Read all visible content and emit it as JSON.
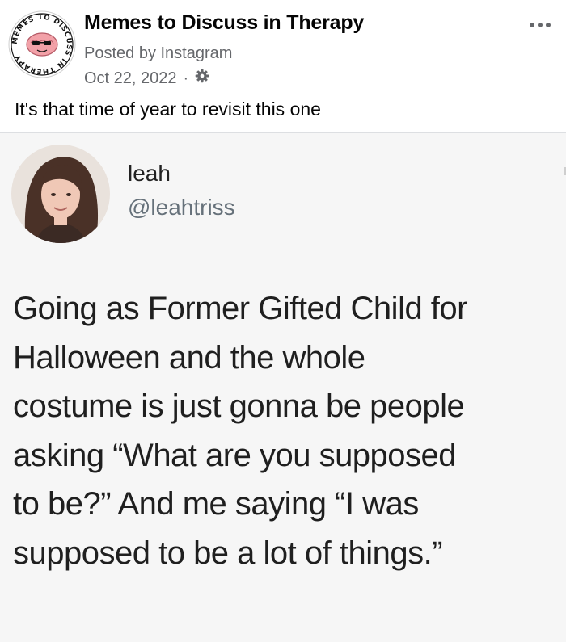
{
  "post": {
    "page_name": "Memes to Discuss in Therapy",
    "posted_by": "Posted by Instagram",
    "date": "Oct 22, 2022",
    "meta_separator": "·",
    "privacy_icon": "gear-icon",
    "more_icon": "more-options-icon",
    "caption": "It's that time of year to revisit this one",
    "avatar_ring_text": "MEMES TO DISCUSS IN THERAPY"
  },
  "tweet": {
    "name": "leah",
    "handle": "@leahtriss",
    "body_lines": [
      "Going as Former Gifted Child for",
      "Halloween and the whole",
      "costume is just gonna be people",
      "asking “What are you supposed",
      "to be?” And me saying “I was",
      "supposed to be a lot of things.”"
    ]
  },
  "colors": {
    "primary_text": "#050505",
    "secondary_text": "#65676b",
    "tweet_background": "#f6f6f6",
    "handle_gray": "#66717a"
  }
}
